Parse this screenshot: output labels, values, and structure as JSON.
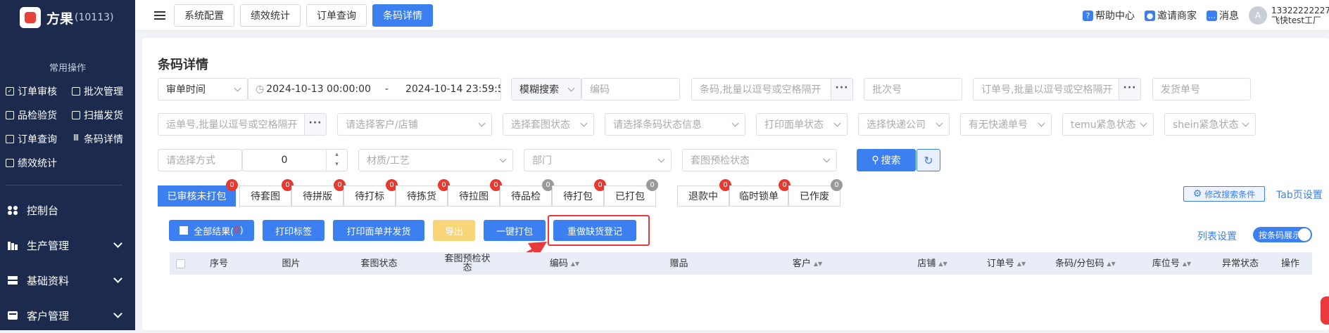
{
  "app": {
    "name": "方果",
    "count": "(10113)"
  },
  "sidebar": {
    "common_title": "常用操作",
    "quick": [
      {
        "label": "订单审核",
        "icon": "check-square-icon"
      },
      {
        "label": "批次管理",
        "icon": "grid-icon"
      },
      {
        "label": "品检验货",
        "icon": "inspect-icon"
      },
      {
        "label": "扫描发货",
        "icon": "scan-icon"
      },
      {
        "label": "订单查询",
        "icon": "search-doc-icon"
      },
      {
        "label": "条码详情",
        "icon": "barcode-icon"
      },
      {
        "label": "绩效统计",
        "icon": "chart-icon"
      }
    ],
    "menu": [
      {
        "label": "控制台",
        "icon": "dashboard-icon"
      },
      {
        "label": "生产管理",
        "icon": "factory-icon"
      },
      {
        "label": "基础资料",
        "icon": "database-icon"
      },
      {
        "label": "客户管理",
        "icon": "customer-icon"
      }
    ]
  },
  "topbar": {
    "tabs": [
      "系统配置",
      "绩效统计",
      "订单查询",
      "条码详情"
    ],
    "active_tab": 3,
    "links": [
      "帮助中心",
      "邀请商家",
      "消息"
    ],
    "user": {
      "phone": "13322222227",
      "shop": "飞快test工厂"
    }
  },
  "page": {
    "title": "条码详情"
  },
  "filters": {
    "time_type": "审单时间",
    "date_start": "2024-10-13 00:00:00",
    "date_sep": "-",
    "date_end": "2024-10-14 23:59:59",
    "search_mode": "模糊搜索",
    "code_ph": "编码",
    "barcode_ph": "条码,批量以逗号或空格隔开",
    "batch_ph": "批次号",
    "order_ph": "订单号,批量以逗号或空格隔开",
    "ship_ph": "发货单号",
    "waybill_ph": "运单号,批量以逗号或空格隔开",
    "customer_ph": "请选择客户/店铺",
    "theme_ph": "选择套图状态",
    "barcode_status_ph": "请选择条码状态信息",
    "print_ph": "打印面单状态",
    "express_ph": "选择快递公司",
    "has_express_ph": "有无快递单号",
    "temu_ph": "temu紧急状态",
    "shein_ph": "shein紧急状态",
    "method_ph": "请选择方式",
    "num_value": "0",
    "material_ph": "材质/工艺",
    "dept_ph": "部门",
    "precheck_ph": "套图预检状态",
    "search_btn": "搜索",
    "dots": "···"
  },
  "status_tabs": [
    {
      "label": "已审核未打包",
      "badge": "0",
      "gray": false
    },
    {
      "label": "待套图",
      "badge": "0",
      "gray": false
    },
    {
      "label": "待拼版",
      "badge": "0",
      "gray": false
    },
    {
      "label": "待打标",
      "badge": "0",
      "gray": false
    },
    {
      "label": "待拣货",
      "badge": "0",
      "gray": false
    },
    {
      "label": "待拉图",
      "badge": "0",
      "gray": false
    },
    {
      "label": "待品检",
      "badge": "0",
      "gray": true
    },
    {
      "label": "待打包",
      "badge": "0",
      "gray": false
    },
    {
      "label": "已打包",
      "badge": "0",
      "gray": true
    },
    {
      "label": "退款中",
      "badge": "0",
      "gray": false
    },
    {
      "label": "临时锁单",
      "badge": "0",
      "gray": false
    },
    {
      "label": "已作废",
      "badge": "0",
      "gray": true
    }
  ],
  "modify_search": "修改搜索条件",
  "tab_settings": "Tab页设置",
  "actions": {
    "all_results": "全部结果(",
    "all_count": "0",
    "all_close": ")",
    "print_label": "打印标签",
    "print_ship": "打印面单并发货",
    "export": "导出",
    "pack": "一键打包",
    "redo": "重做缺货登记"
  },
  "list_settings": "列表设置",
  "toggle_label": "按条码展示",
  "columns": [
    "序号",
    "图片",
    "套图状态",
    "套图预检状态",
    "编码",
    "赠品",
    "客户",
    "店铺",
    "订单号",
    "条码/分包码",
    "库位号",
    "异常状态",
    "操作"
  ],
  "colors": {
    "primary": "#3b7ff0",
    "sidebar": "#1c2a4d",
    "badge_red": "#e6392f",
    "annotation": "#e8393c"
  }
}
